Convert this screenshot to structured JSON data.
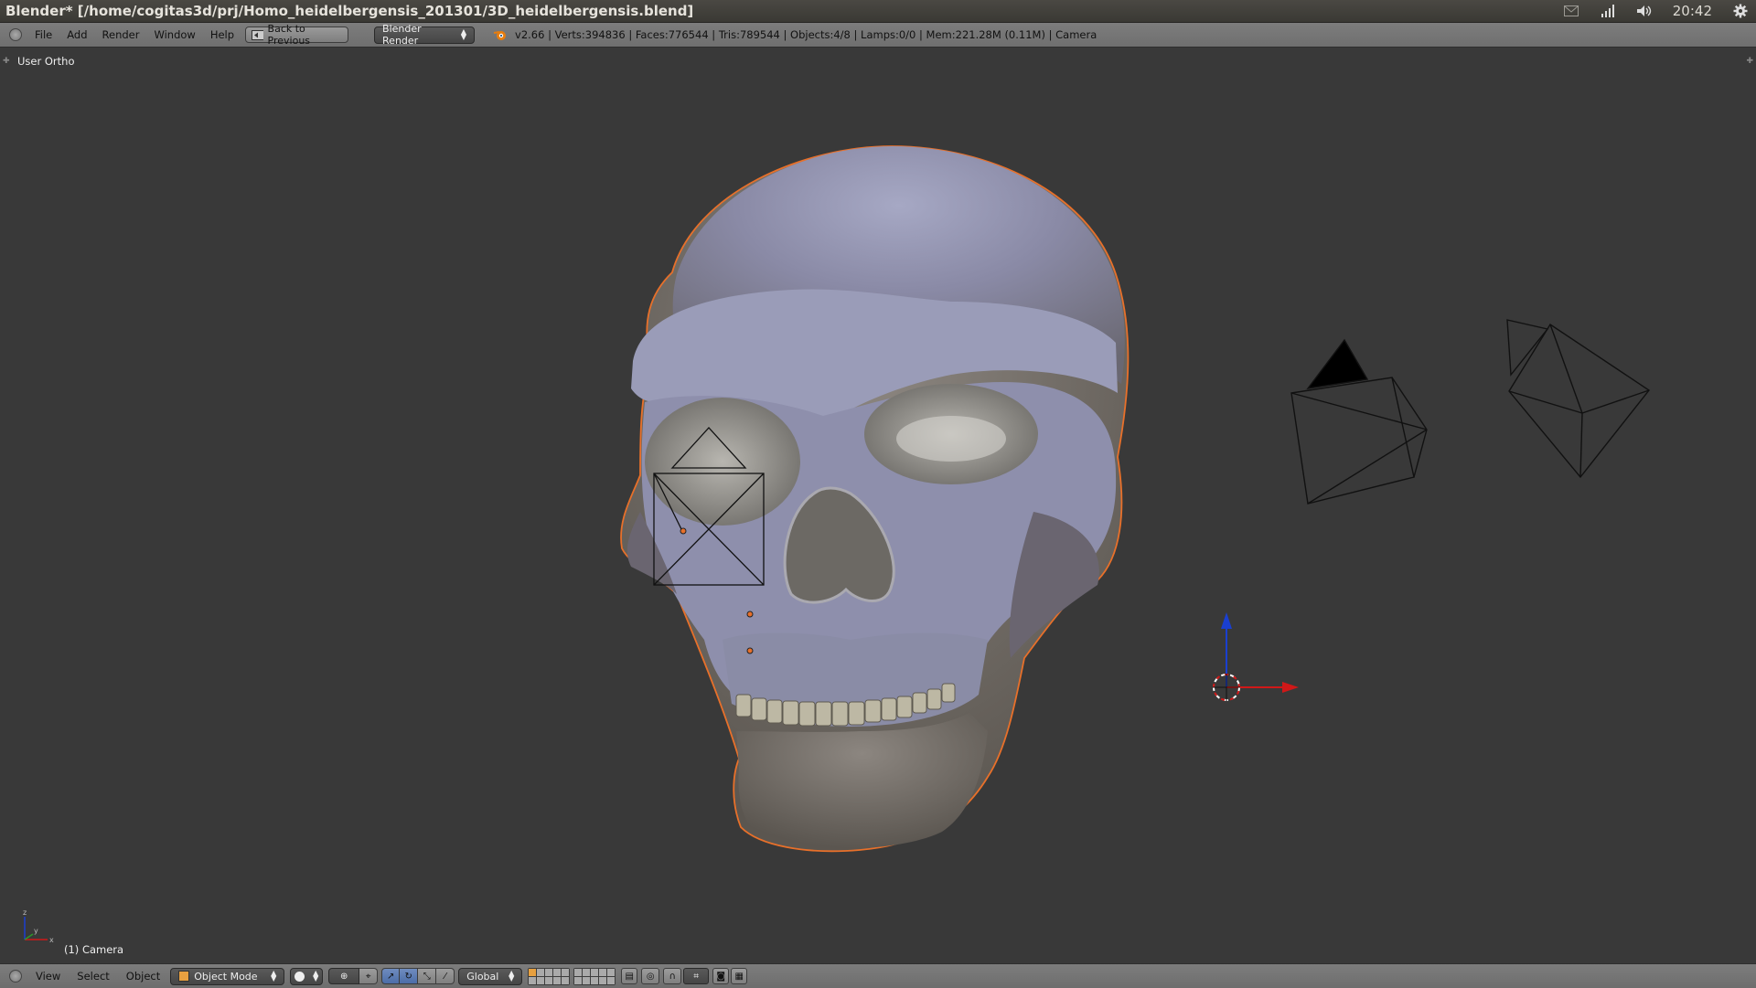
{
  "os_titlebar": {
    "title": "Blender* [/home/cogitas3d/prj/Homo_heidelbergensis_201301/3D_heidelbergensis.blend]",
    "clock": "20:42",
    "icons": [
      "mail-icon",
      "network-signal-icon",
      "volume-icon",
      "gear-icon"
    ]
  },
  "info_header": {
    "menus": [
      "File",
      "Add",
      "Render",
      "Window",
      "Help"
    ],
    "back_button": "Back to Previous",
    "render_engine": "Blender Render",
    "stats": "v2.66 | Verts:394836 | Faces:776544 | Tris:789544 | Objects:4/8 | Lamps:0/0 | Mem:221.28M (0.11M) | Camera"
  },
  "viewport": {
    "view_name": "User Ortho",
    "active_object": "(1) Camera",
    "axis_labels": {
      "x": "x",
      "y": "y",
      "z": "z"
    }
  },
  "view3d_header": {
    "menus": [
      "View",
      "Select",
      "Object"
    ],
    "mode": "Object Mode",
    "orientation": "Global"
  },
  "colors": {
    "background": "#393939",
    "header": "#727272",
    "selection_outline": "#e8702a",
    "axis_x": "#d01818",
    "axis_z": "#1a3fd0"
  }
}
